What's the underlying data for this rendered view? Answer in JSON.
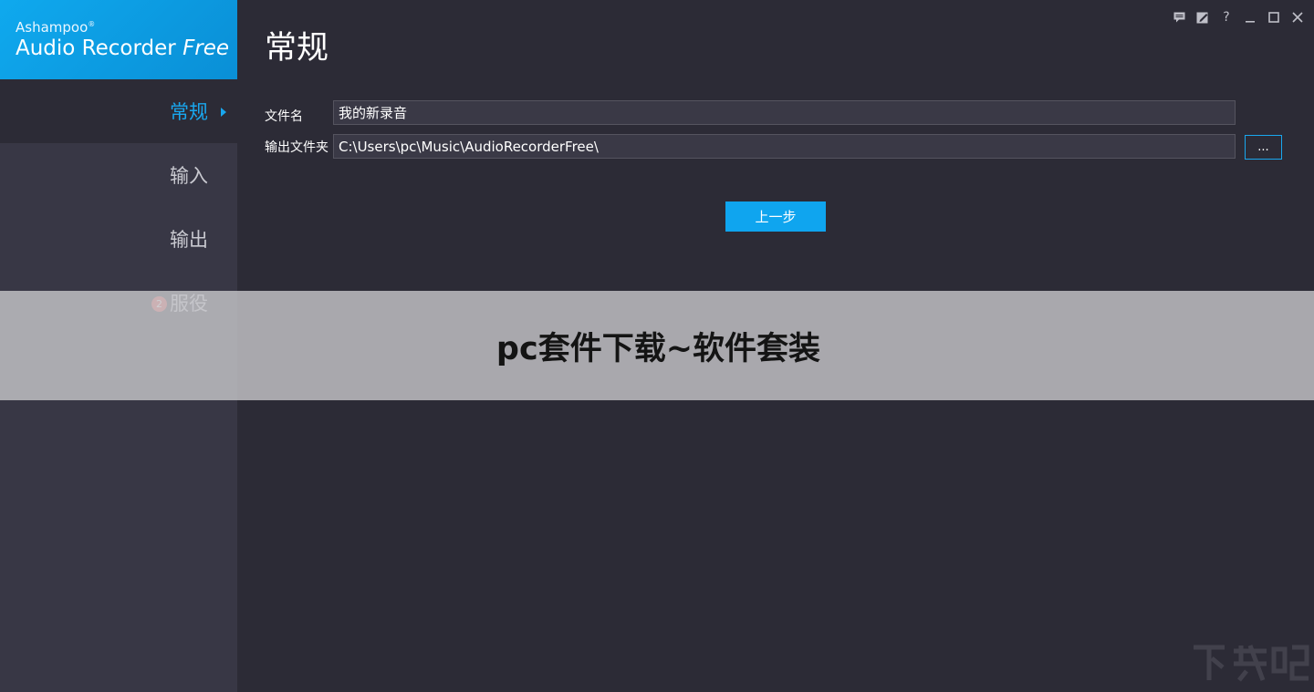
{
  "sidebar": {
    "logo": {
      "brand": "Ashampoo",
      "trademark": "®",
      "product": "Audio Recorder",
      "edition": "Free"
    },
    "items": [
      {
        "label": "常规",
        "active": true
      },
      {
        "label": "输入",
        "active": false
      },
      {
        "label": "输出",
        "active": false
      },
      {
        "label": "服役",
        "active": false,
        "badge": "2"
      }
    ]
  },
  "window_controls": [
    "chat-icon",
    "edit-icon",
    "help-icon",
    "minimize-icon",
    "maximize-icon",
    "close-icon"
  ],
  "window_control_glyphs": {
    "help": "?"
  },
  "main": {
    "title": "常规",
    "filename": {
      "label": "文件名",
      "value": "我的新录音"
    },
    "output_folder": {
      "label": "输出文件夹",
      "value": "C:\\Users\\pc\\Music\\AudioRecorderFree\\"
    },
    "browse_label": "...",
    "back_label": "上一步"
  },
  "banner": {
    "text": "pc套件下载~软件套装"
  },
  "colors": {
    "accent": "#0fa5ef",
    "background": "#2c2b36",
    "sidebar": "#383745"
  }
}
